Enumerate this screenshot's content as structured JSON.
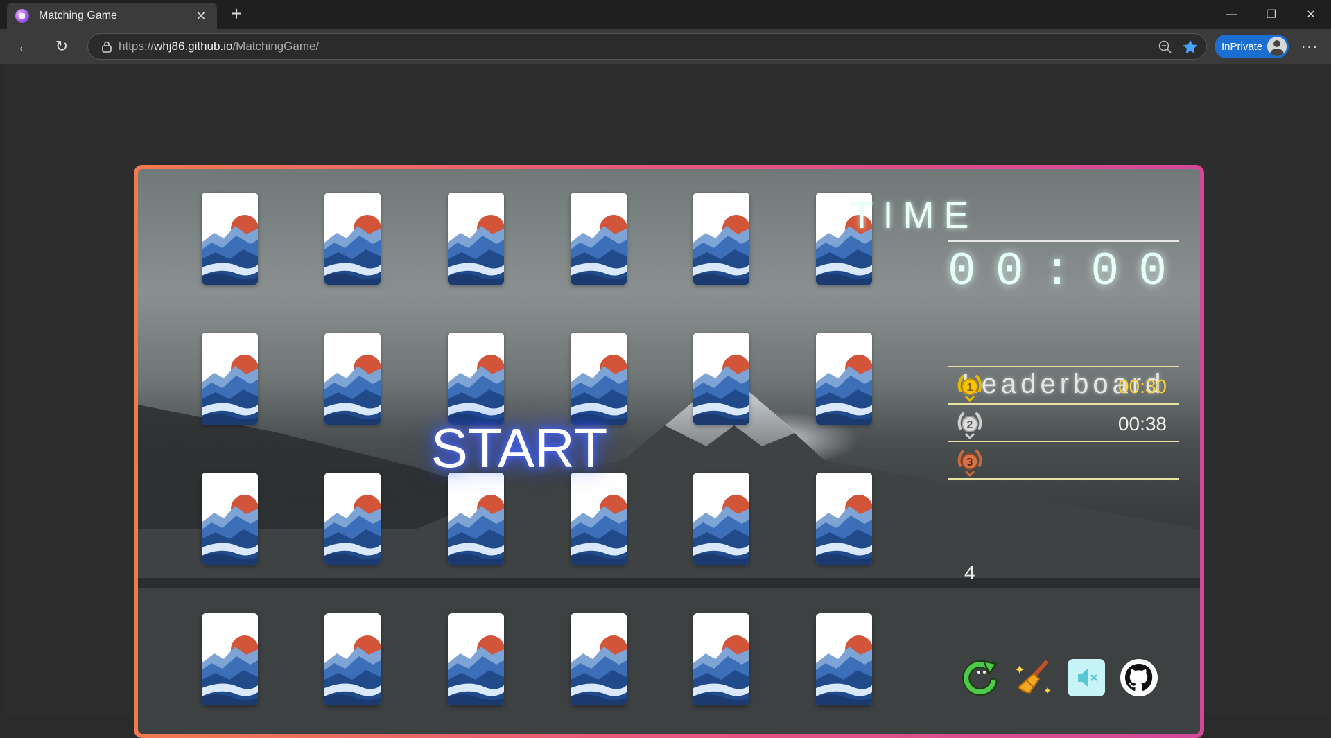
{
  "browser": {
    "tab_title": "Matching Game",
    "url_prefix": "https://",
    "url_host": "whj86.github.io",
    "url_path": "/MatchingGame/",
    "inprivate_label": "InPrivate"
  },
  "game": {
    "start_label": "START",
    "time_title": "TIME",
    "time_value": "00:00",
    "leaderboard_title": "Leaderboard",
    "leaderboard": [
      {
        "rank": "1",
        "time": "00:30",
        "medal_color": "#e6b800"
      },
      {
        "rank": "2",
        "time": "00:38",
        "medal_color": "#c9c9c9"
      },
      {
        "rank": "3",
        "time": "",
        "medal_color": "#c7683e"
      }
    ],
    "leaderboard_next_rank": "4",
    "card_count": 24,
    "tools": [
      "restart-icon",
      "broom-icon",
      "mute-icon",
      "github-icon"
    ]
  }
}
